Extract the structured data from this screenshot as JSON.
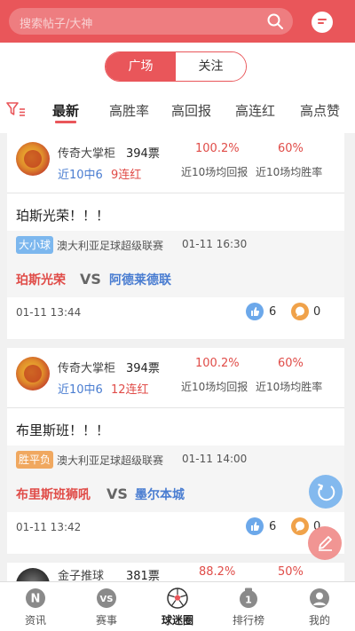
{
  "header": {
    "search_placeholder": "搜索帖子/大神",
    "search_icon": "search-icon",
    "message_icon": "message-icon"
  },
  "segment": {
    "left": "广场",
    "right": "关注"
  },
  "tabs": [
    "最新",
    "高胜率",
    "高回报",
    "高连红",
    "高点赞"
  ],
  "active_tab": "最新",
  "posts": [
    {
      "user": "传奇大掌柜",
      "votes": "394票",
      "recent": "近10中6",
      "streak": "9连红",
      "return_rate": "100.2%",
      "return_label": "近10场均回报",
      "win_rate": "60%",
      "win_label": "近10场均胜率",
      "title": "珀斯光荣！！！",
      "badge": "大小球",
      "badge_color": "#7cb7ee",
      "league": "澳大利亚足球超级联赛",
      "match_time": "01-11 16:30",
      "home": "珀斯光荣",
      "vs": "VS",
      "away": "阿德莱德联",
      "post_time": "01-11 13:44",
      "likes": "6",
      "comments": "0"
    },
    {
      "user": "传奇大掌柜",
      "votes": "394票",
      "recent": "近10中6",
      "streak": "12连红",
      "return_rate": "100.2%",
      "return_label": "近10场均回报",
      "win_rate": "60%",
      "win_label": "近10场均胜率",
      "title": "布里斯班！！！",
      "badge": "胜平负",
      "badge_color": "#f0a860",
      "league": "澳大利亚足球超级联赛",
      "match_time": "01-11 14:00",
      "home": "布里斯班狮吼",
      "vs": "VS",
      "away": "墨尔本城",
      "post_time": "01-11 13:42",
      "likes": "6",
      "comments": "0"
    },
    {
      "user": "金子推球",
      "votes": "381票",
      "return_rate": "88.2%",
      "win_rate": "50%"
    }
  ],
  "bottom_nav": [
    {
      "label": "资讯",
      "icon": "news-icon"
    },
    {
      "label": "赛事",
      "icon": "vs-icon"
    },
    {
      "label": "球迷圈",
      "icon": "soccer-ball-icon"
    },
    {
      "label": "排行榜",
      "icon": "ranking-icon"
    },
    {
      "label": "我的",
      "icon": "profile-icon"
    }
  ],
  "colors": {
    "brand": "#e9565a",
    "blue": "#4a7dd1",
    "red_text": "#e04c48"
  }
}
